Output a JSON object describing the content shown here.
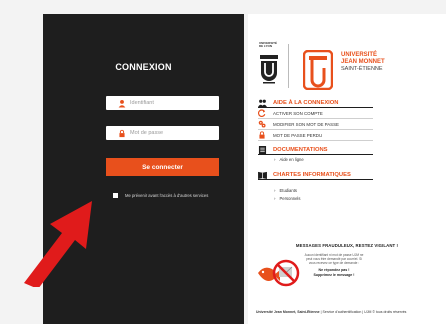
{
  "login": {
    "title": "CONNEXION",
    "identifier_placeholder": "Identifiant",
    "password_placeholder": "Mot de passe",
    "connect_label": "Se connecter",
    "warn_label": "Me prévenir avant l'accès à d'autres services"
  },
  "brand": {
    "ujm_small": "UNIVERSITÉ DE LYON",
    "name_line1": "UNIVERSITÉ",
    "name_line2": "JEAN MONNET",
    "name_line3": "SAINT-ÉTIENNE"
  },
  "menu": {
    "help_heading": "AIDE À LA CONNEXION",
    "help_items": [
      "ACTIVER SON COMPTE",
      "MODIFIER SON MOT DE PASSE",
      "MOT DE PASSE PERDU"
    ],
    "docs_heading": "DOCUMENTATIONS",
    "docs_items": [
      "Aide en ligne"
    ],
    "charters_heading": "CHARTES INFORMATIQUES",
    "charters_items": [
      "Etudiants",
      "Personnels"
    ]
  },
  "phishing": {
    "title": "MESSAGES FRAUDULEUX, RESTEZ VIGILANT !",
    "body": "Aucun identifiant ni mot de passe UJM ne peut vous être demandé par courriel. Si vous recevez ce type de demande :",
    "line1": "Ne répondez pas !",
    "line2": "Supprimez le message !"
  },
  "footer": {
    "org": "Université Jean Monnet, Saint-Étienne",
    "service": "Service d'authentification",
    "copyright": "UJM © tous droits réservés"
  },
  "colors": {
    "accent": "#e8501c",
    "dark_panel": "#1e1e1e",
    "arrow": "#e01b1b"
  }
}
